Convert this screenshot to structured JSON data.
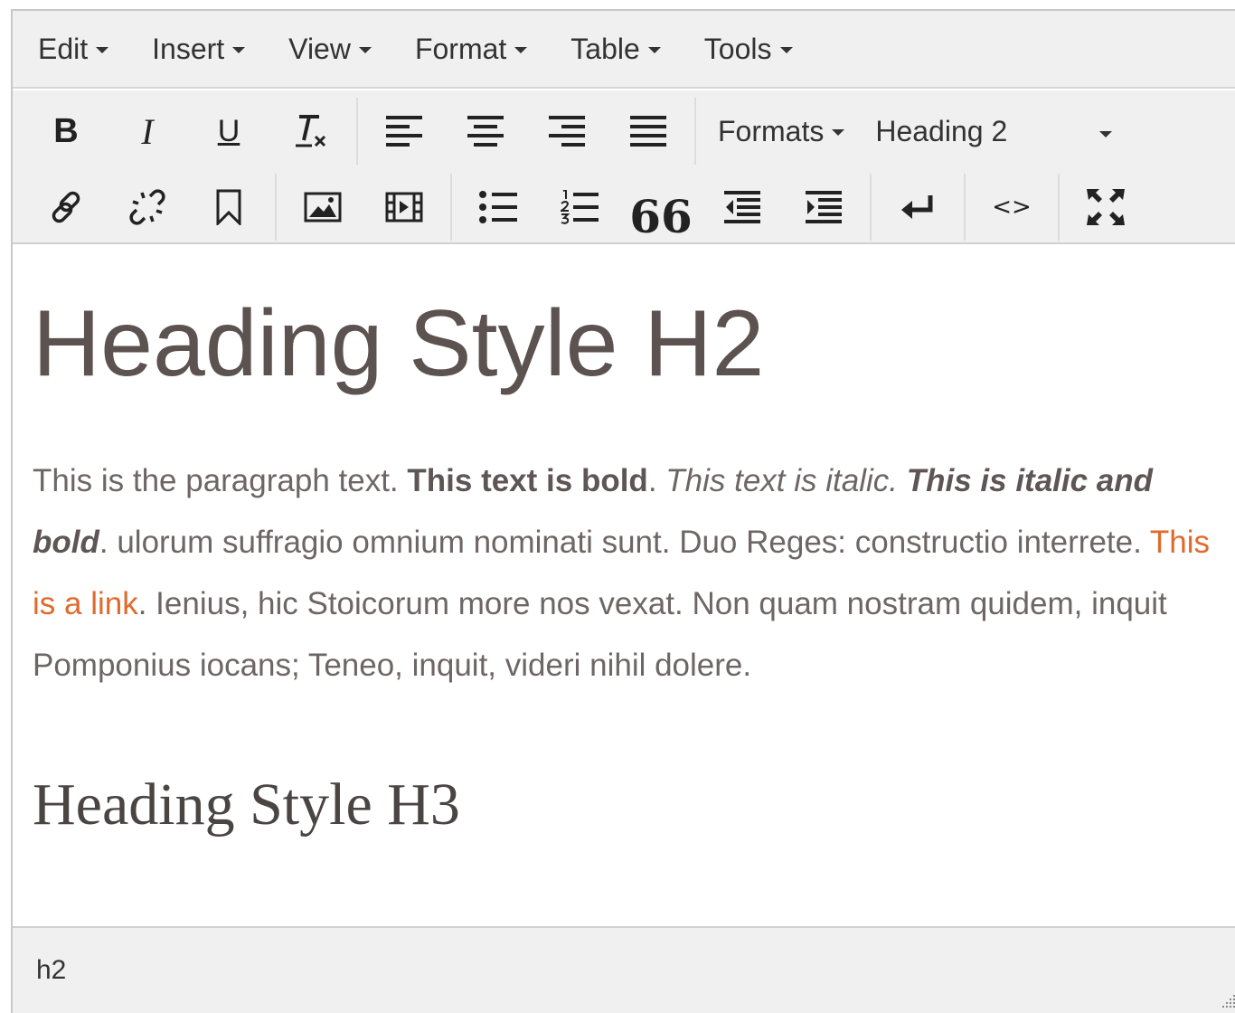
{
  "menubar": {
    "items": [
      {
        "label": "Edit"
      },
      {
        "label": "Insert"
      },
      {
        "label": "View"
      },
      {
        "label": "Format"
      },
      {
        "label": "Table"
      },
      {
        "label": "Tools"
      }
    ]
  },
  "toolbar": {
    "bold_glyph": "B",
    "italic_glyph": "I",
    "underline_glyph": "U",
    "formats_label": "Formats",
    "block_format_value": "Heading 2",
    "blockquote_glyph": "66",
    "code_glyph": "<>"
  },
  "content": {
    "heading2": "Heading Style H2",
    "paragraph": {
      "t1": "This is the paragraph text. ",
      "bold": "This text is bold",
      "t2": ". ",
      "italic": "This text is italic.",
      "t3": " ",
      "bold_italic": "This is italic and bold",
      "t4": ". ulorum suffragio omnium nominati sunt. Duo Reges: constructio interrete. ",
      "link": "This is a link",
      "t5": ".  Ienius, hic Stoicorum more nos vexat. Non quam nostram quidem, inquit Pomponius iocans; Teneo, inquit, videri nihil dolere."
    },
    "heading3": "Heading Style H3"
  },
  "statusbar": {
    "path": "h2"
  },
  "colors": {
    "chrome_bg": "#f0f0f0",
    "heading_text": "#5c5250",
    "body_text": "#6e6664",
    "link": "#e06a2c"
  },
  "icons": [
    "bold-icon",
    "italic-icon",
    "underline-icon",
    "clear-formatting-icon",
    "align-left-icon",
    "align-center-icon",
    "align-right-icon",
    "align-justify-icon",
    "link-icon",
    "unlink-icon",
    "bookmark-icon",
    "image-icon",
    "video-icon",
    "bullet-list-icon",
    "numbered-list-icon",
    "blockquote-icon",
    "outdent-icon",
    "indent-icon",
    "line-break-icon",
    "code-icon",
    "fullscreen-icon",
    "resize-handle-icon"
  ]
}
